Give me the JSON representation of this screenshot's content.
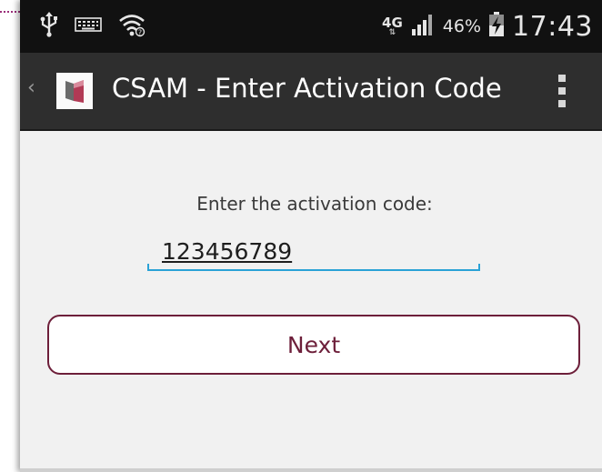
{
  "status_bar": {
    "network_type": "4G",
    "network_arrows": "⇅",
    "battery_percent": "46%",
    "time": "17:43",
    "icons": [
      "usb-icon",
      "keyboard-icon",
      "wifi-icon",
      "signal-icon",
      "battery-charging-icon"
    ]
  },
  "action_bar": {
    "title": "CSAM - Enter Activation Code",
    "up_caret": "‹",
    "app_icon": "csam-logo-icon",
    "overflow_icon": "overflow-menu-icon"
  },
  "form": {
    "prompt": "Enter the activation code:",
    "activation_code_value": "123456789",
    "next_label": "Next"
  },
  "colors": {
    "status_bar_bg": "#111111",
    "action_bar_bg": "#2e2e2e",
    "content_bg": "#f1f1f1",
    "input_underline": "#2aa2d6",
    "button_accent": "#6d1f3a",
    "annotation_dotted_line": "#9b2f7a"
  }
}
